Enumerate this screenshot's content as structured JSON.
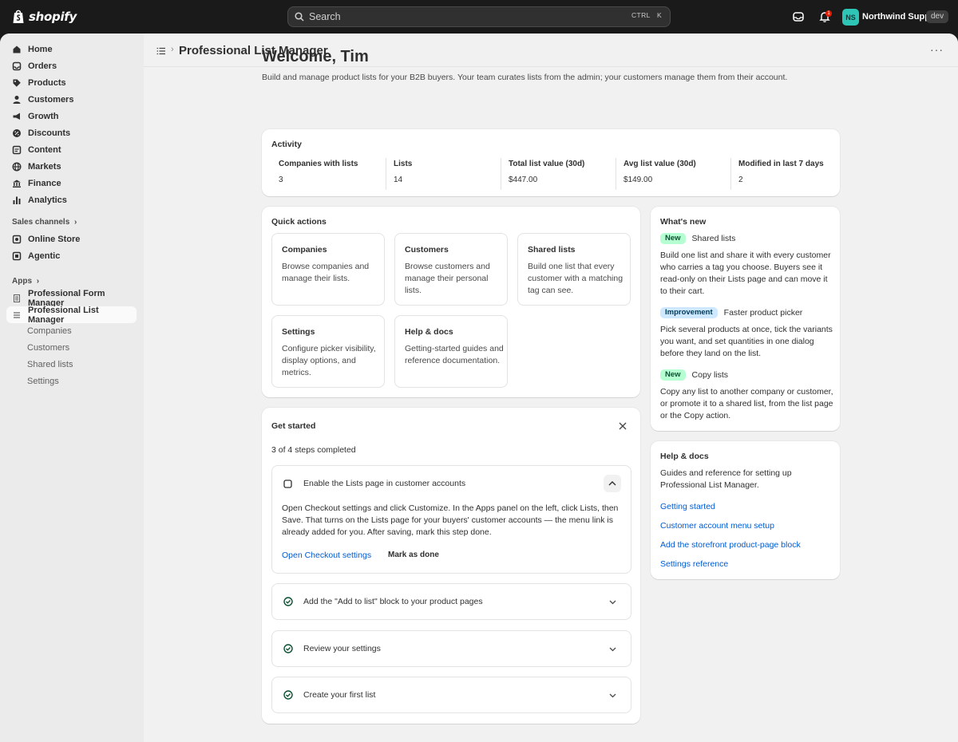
{
  "topbar": {
    "logo_text": "shopify",
    "search_placeholder": "Search",
    "shortcut_ctrl": "CTRL",
    "shortcut_key": "K",
    "notification_count": "1",
    "avatar_initials": "NS",
    "store_name": "Northwind Supply",
    "store_tag": "dev"
  },
  "sidebar": {
    "items": [
      {
        "label": "Home",
        "icon": "home-icon"
      },
      {
        "label": "Orders",
        "icon": "orders-icon"
      },
      {
        "label": "Products",
        "icon": "tag-icon"
      },
      {
        "label": "Customers",
        "icon": "person-icon"
      },
      {
        "label": "Growth",
        "icon": "megaphone-icon"
      },
      {
        "label": "Discounts",
        "icon": "discount-icon"
      },
      {
        "label": "Content",
        "icon": "content-icon"
      },
      {
        "label": "Markets",
        "icon": "globe-icon"
      },
      {
        "label": "Finance",
        "icon": "bank-icon"
      },
      {
        "label": "Analytics",
        "icon": "chart-icon"
      }
    ],
    "sales_channels_label": "Sales channels",
    "channels": [
      {
        "label": "Online Store",
        "icon": "store-icon"
      },
      {
        "label": "Agentic",
        "icon": "agentic-icon"
      }
    ],
    "apps_label": "Apps",
    "apps": [
      {
        "label": "Professional Form Manager",
        "icon": "form-app-icon"
      },
      {
        "label": "Professional List Manager",
        "icon": "list-app-icon",
        "active": true
      }
    ],
    "sub_items": [
      "Companies",
      "Customers",
      "Shared lists",
      "Settings"
    ]
  },
  "header": {
    "title": "Professional List Manager"
  },
  "welcome": {
    "heading": "Welcome, Tim",
    "intro": "Build and manage product lists for your B2B buyers. Your team curates lists from the admin; your customers manage them from their account."
  },
  "activity": {
    "title": "Activity",
    "metrics": [
      {
        "label": "Companies with lists",
        "value": "3"
      },
      {
        "label": "Lists",
        "value": "14"
      },
      {
        "label": "Total list value (30d)",
        "value": "$447.00"
      },
      {
        "label": "Avg list value (30d)",
        "value": "$149.00"
      },
      {
        "label": "Modified in last 7 days",
        "value": "2"
      }
    ]
  },
  "quick_actions": {
    "title": "Quick actions",
    "items": [
      {
        "title": "Companies",
        "desc": "Browse companies and manage their lists."
      },
      {
        "title": "Customers",
        "desc": "Browse customers and manage their personal lists."
      },
      {
        "title": "Shared lists",
        "desc": "Build one list that every customer with a matching tag can see."
      },
      {
        "title": "Settings",
        "desc": "Configure picker visibility, display options, and metrics."
      },
      {
        "title": "Help & docs",
        "desc": "Getting-started guides and reference documentation."
      }
    ]
  },
  "whats_new": {
    "title": "What's new",
    "items": [
      {
        "badge": "New",
        "heading": "Shared lists",
        "text": "Build one list and share it with every customer who carries a tag you choose. Buyers see it read-only on their Lists page and can move it to their cart."
      },
      {
        "badge": "Improvement",
        "heading": "Faster product picker",
        "text": "Pick several products at once, tick the variants you want, and set quantities in one dialog before they land on the list."
      },
      {
        "badge": "New",
        "heading": "Copy lists",
        "text": "Copy any list to another company or customer, or promote it to a shared list, from the list page or the Copy action."
      }
    ]
  },
  "help_docs": {
    "title": "Help & docs",
    "text": "Guides and reference for setting up Professional List Manager.",
    "links": [
      "Getting started",
      "Customer account menu setup",
      "Add the storefront product-page block",
      "Settings reference"
    ]
  },
  "get_started": {
    "title": "Get started",
    "progress": "3 of 4 steps completed",
    "steps": [
      {
        "title": "Enable the Lists page in customer accounts",
        "done": false,
        "expanded": true,
        "body": "Open Checkout settings and click Customize. In the Apps panel on the left, click Lists, then Save. That turns on the Lists page for your buyers' customer accounts — the menu link is already added for you. After saving, mark this step done.",
        "primary": "Open Checkout settings",
        "secondary": "Mark as done"
      },
      {
        "title": "Add the \"Add to list\" block to your product pages",
        "done": true
      },
      {
        "title": "Review your settings",
        "done": true
      },
      {
        "title": "Create your first list",
        "done": true
      }
    ]
  },
  "colors": {
    "accent_link": "#005bd3",
    "success": "#0c5132",
    "topbar": "#1a1a1a"
  }
}
